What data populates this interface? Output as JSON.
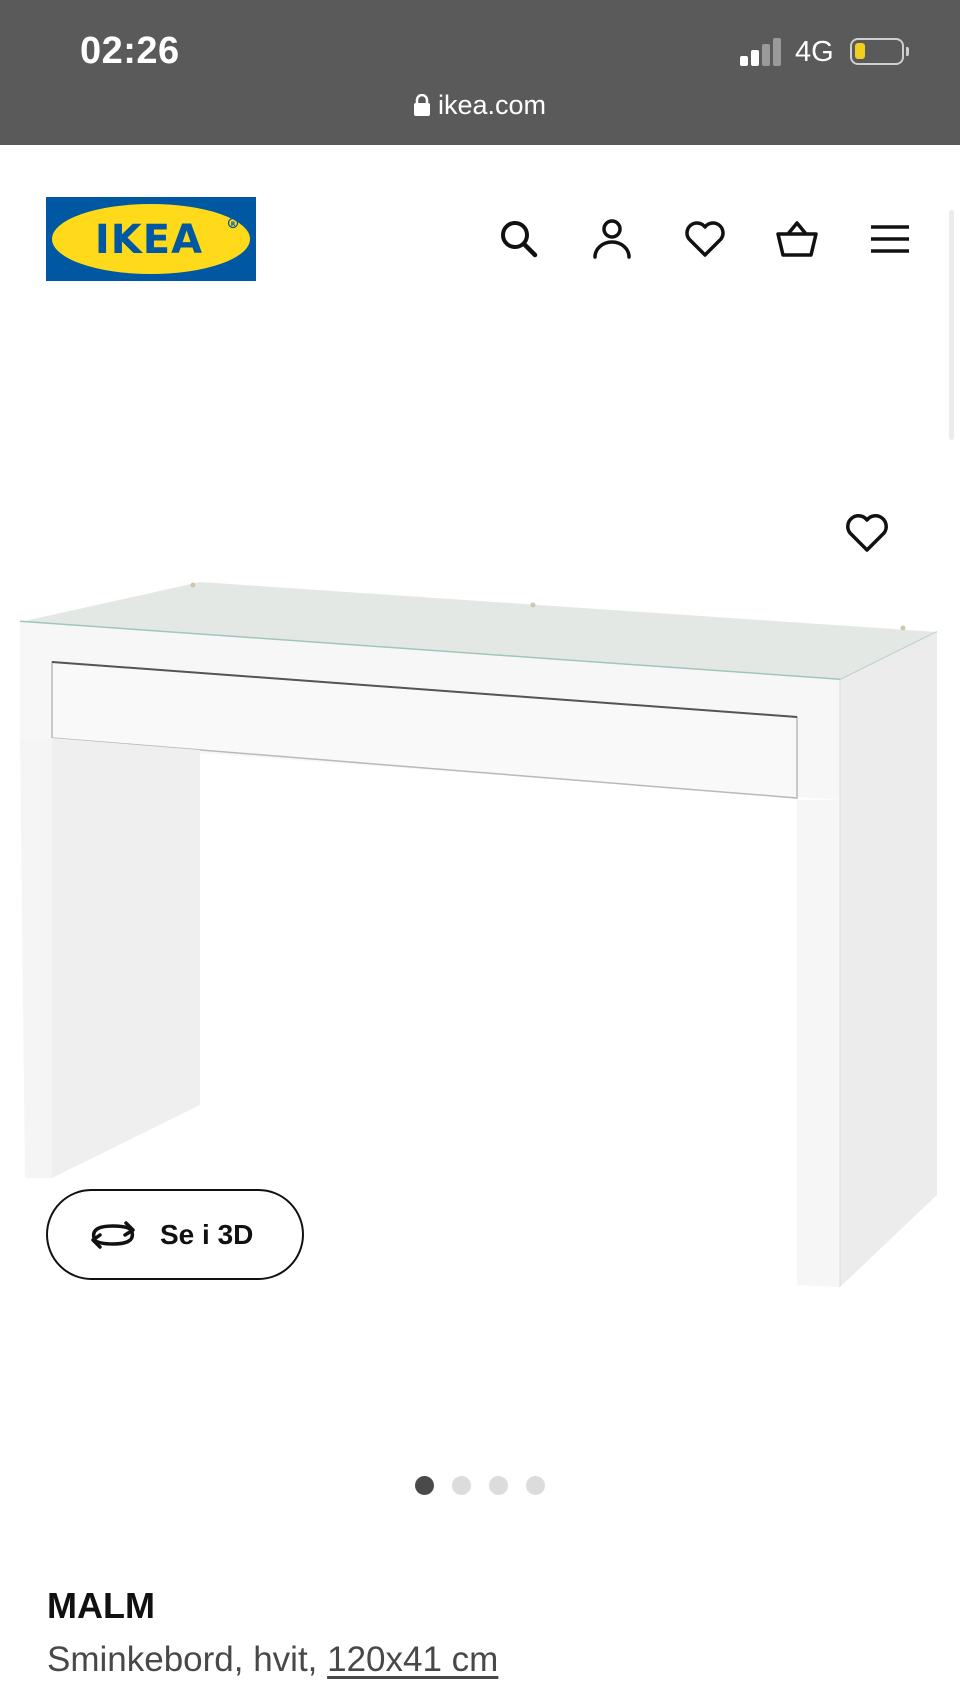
{
  "status_bar": {
    "time": "02:26",
    "network": "4G",
    "battery_level": 0.22,
    "battery_color": "#f1cf1f"
  },
  "browser": {
    "url": "ikea.com"
  },
  "header": {
    "logo_text": "IKEA",
    "logo_colors": {
      "blue": "#0058a3",
      "yellow": "#ffda1a"
    },
    "icons": [
      "search-icon",
      "account-icon",
      "favourites-icon",
      "cart-icon",
      "menu-icon"
    ]
  },
  "product": {
    "view_3d_label": "Se i 3D",
    "carousel": {
      "count": 4,
      "active_index": 0
    },
    "name": "MALM",
    "description_prefix": "Sminkebord, hvit, ",
    "dimensions": "120x41 cm"
  }
}
